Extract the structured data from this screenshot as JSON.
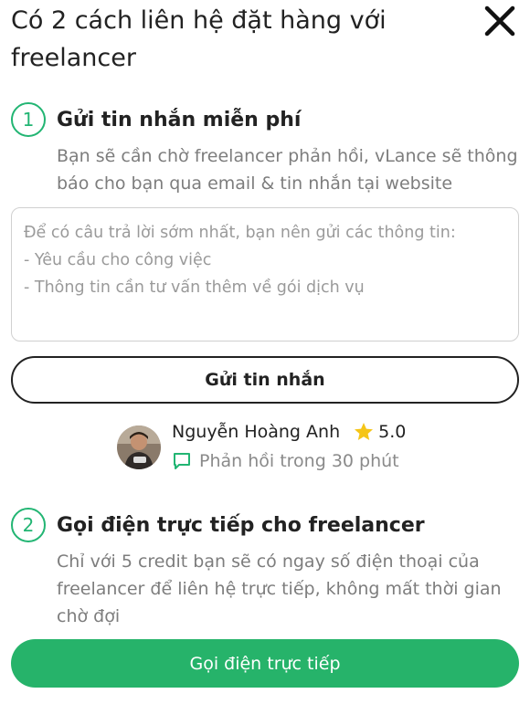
{
  "header": {
    "title": "Có 2 cách liên hệ đặt hàng với freelancer",
    "close_icon": "close-icon"
  },
  "step1": {
    "number": "1",
    "title": "Gửi tin nhắn miễn phí",
    "description": "Bạn sẽ cần chờ freelancer phản hồi, vLance sẽ thông báo cho bạn qua email & tin nhắn tại website"
  },
  "message": {
    "placeholder": "Để có câu trả lời sớm nhất, bạn nên gửi các thông tin:\n- Yêu cầu cho công việc\n- Thông tin cần tư vấn thêm về gói dịch vụ",
    "send_label": "Gửi tin nhắn"
  },
  "freelancer": {
    "name": "Nguyễn Hoàng Anh",
    "rating": "5.0",
    "response_time": "Phản hồi trong 30 phút",
    "rating_icon": "star-icon",
    "response_icon": "chat-icon"
  },
  "step2": {
    "number": "2",
    "title": "Gọi điện trực tiếp cho freelancer",
    "description": "Chỉ với 5 credit bạn sẽ có ngay số điện thoại của freelancer để liên hệ trực tiếp, không mất thời gian chờ đợi",
    "call_label": "Gọi điện trực tiếp"
  },
  "colors": {
    "accent": "#22b573",
    "button_green": "#26b36a",
    "star": "#f5c518",
    "text": "#222222",
    "muted": "#7d7d7d"
  }
}
